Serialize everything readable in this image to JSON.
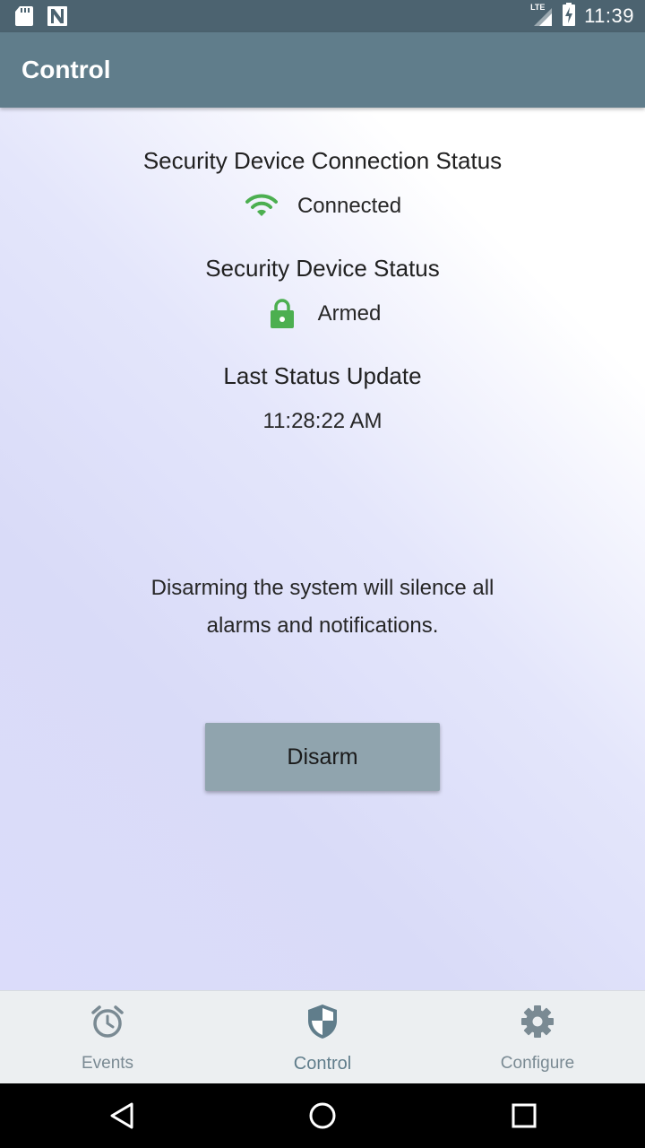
{
  "status_bar": {
    "time": "11:39",
    "network_label": "LTE",
    "icons": [
      "sd-card-icon",
      "notification-n-icon",
      "lte-signal-icon",
      "battery-charging-icon"
    ]
  },
  "app_bar": {
    "title": "Control",
    "color": "#607d8b"
  },
  "main": {
    "connection": {
      "heading": "Security Device Connection Status",
      "value": "Connected",
      "icon": "wifi-icon",
      "icon_color": "#4caf50"
    },
    "device": {
      "heading": "Security Device Status",
      "value": "Armed",
      "icon": "lock-icon",
      "icon_color": "#4caf50"
    },
    "last_update": {
      "heading": "Last Status Update",
      "value": "11:28:22 AM"
    },
    "info_text": "Disarming the system will silence all alarms and notifications.",
    "disarm_button": {
      "label": "Disarm",
      "color": "#90a4ae"
    }
  },
  "bottom_nav": {
    "items": [
      {
        "label": "Events",
        "icon": "alarm-clock-icon",
        "active": false
      },
      {
        "label": "Control",
        "icon": "shield-icon",
        "active": true
      },
      {
        "label": "Configure",
        "icon": "gear-icon",
        "active": false
      }
    ]
  },
  "system_nav": {
    "buttons": [
      "back-icon",
      "home-icon",
      "recents-icon"
    ]
  }
}
